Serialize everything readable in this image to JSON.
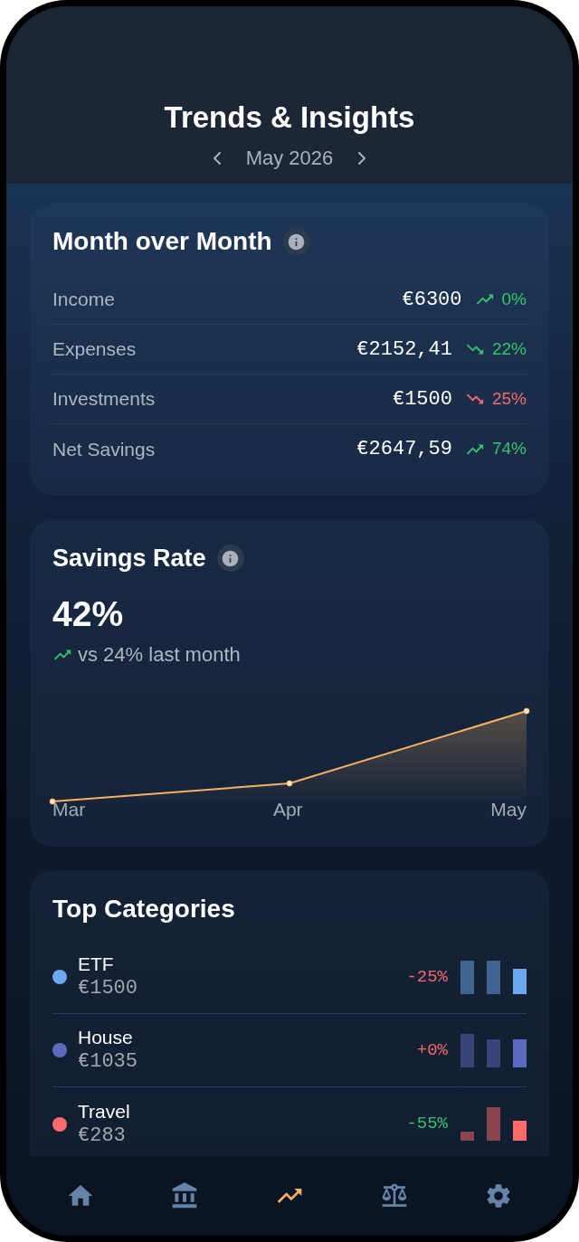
{
  "header": {
    "title": "Trends & Insights",
    "period": "May 2026"
  },
  "month_over_month": {
    "title": "Month over Month",
    "rows": [
      {
        "label": "Income",
        "value": "€6300",
        "trend_up": true,
        "favorable": true,
        "change": "0%"
      },
      {
        "label": "Expenses",
        "value": "€2152,41",
        "trend_up": false,
        "favorable": true,
        "change": "22%"
      },
      {
        "label": "Investments",
        "value": "€1500",
        "trend_up": false,
        "favorable": false,
        "change": "25%"
      },
      {
        "label": "Net Savings",
        "value": "€2647,59",
        "trend_up": true,
        "favorable": true,
        "change": "74%"
      }
    ]
  },
  "savings_rate": {
    "title": "Savings Rate",
    "value": "42%",
    "comparison": {
      "trend_up": true,
      "favorable": true,
      "text": "vs 24% last month"
    },
    "chart_labels": [
      "Mar",
      "Apr",
      "May"
    ]
  },
  "top_categories": {
    "title": "Top Categories",
    "items": [
      {
        "name": "ETF",
        "amount": "€1500",
        "color": "#6aa8f0",
        "change": "-25%",
        "favorable": false
      },
      {
        "name": "House",
        "amount": "€1035",
        "color": "#5c6bc0",
        "change": "+0%",
        "favorable": false
      },
      {
        "name": "Travel",
        "amount": "€283",
        "color": "#ff6b6b",
        "change": "-55%",
        "favorable": true
      }
    ]
  },
  "nav": [
    {
      "kind": "home",
      "selected": false
    },
    {
      "kind": "bank",
      "selected": false
    },
    {
      "kind": "trends",
      "selected": true
    },
    {
      "kind": "balance",
      "selected": false
    },
    {
      "kind": "settings",
      "selected": false
    }
  ]
}
